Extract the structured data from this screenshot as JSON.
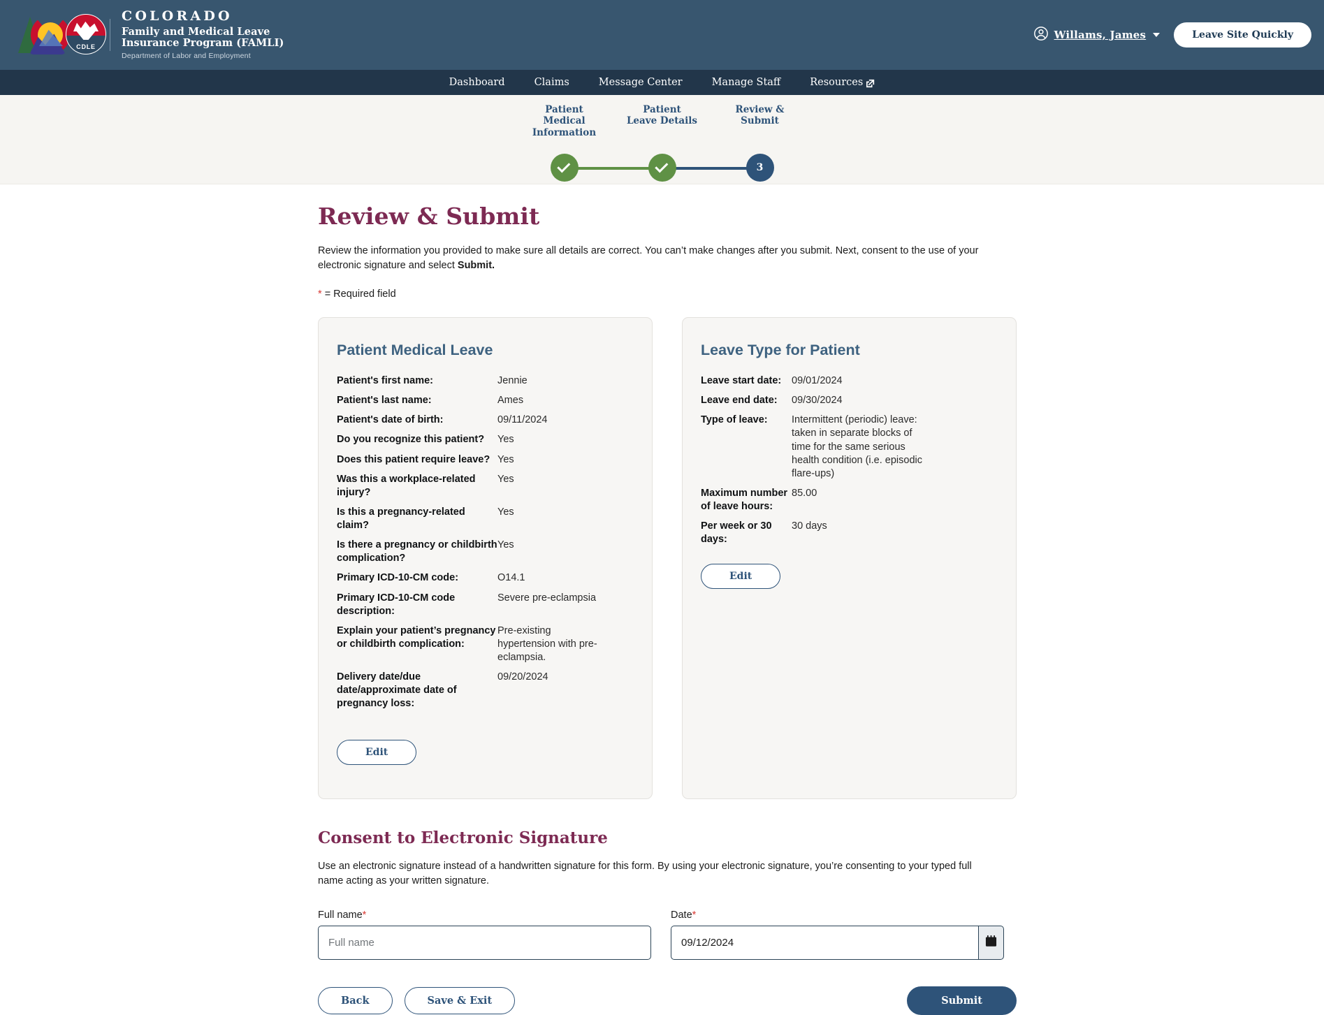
{
  "header": {
    "logo_alt": "Colorado CDLE logo",
    "brand_line1": "COLORADO",
    "brand_line2": "Family and Medical Leave\nInsurance Program (FAMLI)",
    "brand_line2_a": "Family and Medical Leave",
    "brand_line2_b": "Insurance Program (FAMLI)",
    "brand_line3": "Department of Labor and Employment",
    "cdle_badge": "CDLE",
    "user_name": "Willams, James",
    "leave_button": "Leave Site Quickly",
    "bg_color": "#38566f"
  },
  "nav": {
    "items": [
      {
        "label": "Dashboard",
        "external": false
      },
      {
        "label": "Claims",
        "external": false
      },
      {
        "label": "Message Center",
        "external": false
      },
      {
        "label": "Manage Staff",
        "external": false
      },
      {
        "label": "Resources",
        "external": true
      }
    ],
    "bg_color": "#22364a"
  },
  "stepper": {
    "steps": [
      {
        "label_a": "Patient",
        "label_b": "Medical",
        "label_c": "Information",
        "state": "complete",
        "marker": "check"
      },
      {
        "label_a": "Patient",
        "label_b": "Leave Details",
        "label_c": "",
        "state": "complete",
        "marker": "check"
      },
      {
        "label_a": "Review &",
        "label_b": "Submit",
        "label_c": "",
        "state": "current",
        "marker": "3"
      }
    ],
    "complete_color": "#5f9145",
    "current_color": "#2e5379"
  },
  "main": {
    "title": "Review & Submit",
    "intro_part1": "Review the information you provided to make sure all details are correct. You can’t make changes after you submit. Next, consent to the use of your electronic signature and select ",
    "intro_bold": "Submit.",
    "required_note": "= Required field",
    "required_asterisk": "*",
    "title_color": "#7d2a53"
  },
  "cards": [
    {
      "id": "patient-medical-leave",
      "title": "Patient Medical Leave",
      "rows": [
        {
          "label": "Patient's first name:",
          "value": "Jennie"
        },
        {
          "label": "Patient's last name:",
          "value": "Ames"
        },
        {
          "label": "Patient's date of birth:",
          "value": "09/11/2024"
        },
        {
          "label": "Do you recognize this patient?",
          "value": "Yes"
        },
        {
          "label": "Does this patient require leave?",
          "value": "Yes"
        },
        {
          "label": "Was this a workplace-related injury?",
          "value": "Yes"
        },
        {
          "label": "Is this a pregnancy-related claim?",
          "value": "Yes"
        },
        {
          "label": "Is there a pregnancy or childbirth complication?",
          "value": "Yes"
        },
        {
          "label": "Primary ICD-10-CM code:",
          "value": "O14.1"
        },
        {
          "label": "Primary ICD-10-CM code description:",
          "value": "Severe pre-eclampsia"
        },
        {
          "label": "Explain your patient’s pregnancy or childbirth complication:",
          "value": "Pre-existing hypertension with pre-eclampsia."
        },
        {
          "label": "Delivery date/due date/approximate date of pregnancy loss:",
          "value": "09/20/2024"
        }
      ],
      "edit_label": "Edit"
    },
    {
      "id": "leave-type-for-patient",
      "title": "Leave Type for Patient",
      "rows": [
        {
          "label": "Leave start date:",
          "value": "09/01/2024"
        },
        {
          "label": "Leave end date:",
          "value": "09/30/2024"
        },
        {
          "label": "Type of leave:",
          "value": "Intermittent (periodic) leave: taken in separate blocks of time for the same serious health condition (i.e. episodic flare-ups)"
        },
        {
          "label": "Maximum number of leave hours:",
          "value": "85.00"
        },
        {
          "label": "Per week or 30 days:",
          "value": "30 days"
        }
      ],
      "edit_label": "Edit"
    }
  ],
  "consent": {
    "title": "Consent to Electronic Signature",
    "text": "Use an electronic signature instead of a handwritten signature for this form. By using your electronic signature, you’re consenting to your typed full name acting as your written signature.",
    "fullname_label": "Full name",
    "fullname_value": "",
    "fullname_placeholder": "Full name",
    "date_label": "Date",
    "date_value": "09/12/2024",
    "required_asterisk": "*"
  },
  "actions": {
    "back_label": "Back",
    "save_exit_label": "Save & Exit",
    "submit_label": "Submit",
    "primary_color": "#2e5379"
  }
}
